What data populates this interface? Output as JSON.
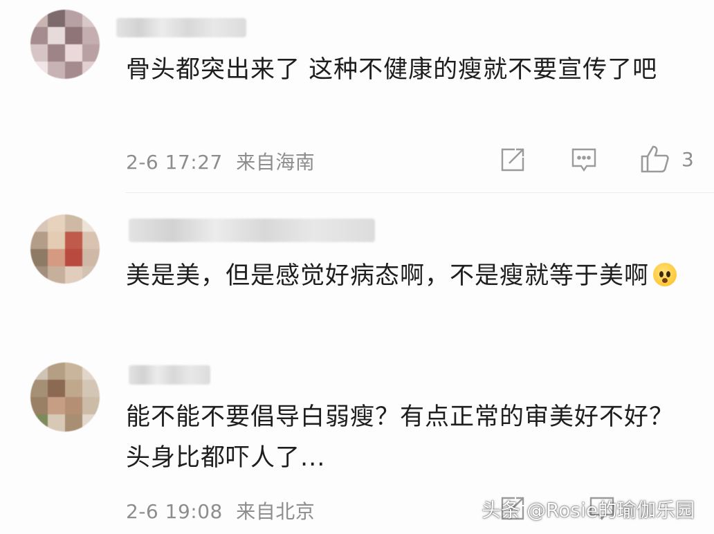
{
  "comments": [
    {
      "text": "骨头都突出来了 这种不健康的瘦就不要宣传了吧",
      "time": "2-6 17:27",
      "location": "来自海南",
      "likes": "3"
    },
    {
      "text": "美是美，但是感觉好病态啊，不是瘦就等于美啊"
    },
    {
      "text": "能不能不要倡导白弱瘦？有点正常的审美好不好？头身比都吓人了...",
      "time": "2-6 19:08",
      "location": "来自北京"
    }
  ],
  "watermark": "头条 @Rosie的瑜伽乐园",
  "icons": {
    "share": "share-icon",
    "reply": "comment-icon",
    "like": "thumbs-up-icon"
  },
  "colors": {
    "text": "#1e1e1e",
    "meta": "#8d8d8d",
    "background": "#fdfdfd"
  }
}
